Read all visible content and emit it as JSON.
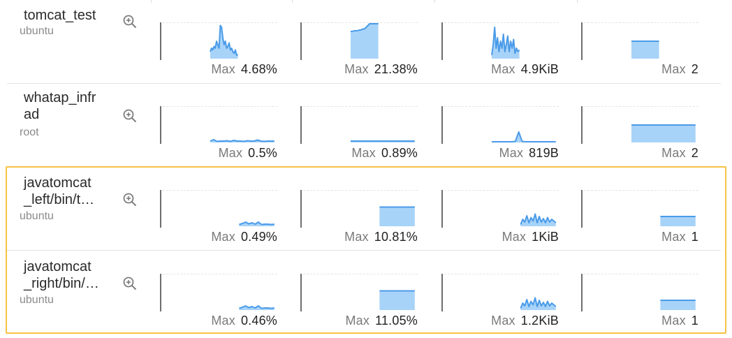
{
  "colors": {
    "accent": "#4a9be8",
    "fill": "#a8d3f8",
    "highlight": "#f6c244"
  },
  "rows": [
    {
      "name": "tomcat_test",
      "user": "ubuntu",
      "icon": "zoom-in-icon",
      "metrics": [
        {
          "max_label": "Max",
          "max_value": "4.68%",
          "shape": "spike"
        },
        {
          "max_label": "Max",
          "max_value": "21.38%",
          "shape": "rise"
        },
        {
          "max_label": "Max",
          "max_value": "4.9KiB",
          "shape": "jagged"
        },
        {
          "max_label": "Max",
          "max_value": "2",
          "shape": "block-mid"
        }
      ]
    },
    {
      "name": "whatap_infr\nad",
      "user": "root",
      "icon": "zoom-in-icon",
      "metrics": [
        {
          "max_label": "Max",
          "max_value": "0.5%",
          "shape": "flat-noise"
        },
        {
          "max_label": "Max",
          "max_value": "0.89%",
          "shape": "flat"
        },
        {
          "max_label": "Max",
          "max_value": "819B",
          "shape": "single-spike"
        },
        {
          "max_label": "Max",
          "max_value": "2",
          "shape": "block-wide"
        }
      ]
    },
    {
      "name": "javatomcat\n_left/bin/t…",
      "user": "ubuntu",
      "icon": "zoom-in-icon",
      "metrics": [
        {
          "max_label": "Max",
          "max_value": "0.49%",
          "shape": "low-noise"
        },
        {
          "max_label": "Max",
          "max_value": "10.81%",
          "shape": "block-tall"
        },
        {
          "max_label": "Max",
          "max_value": "1KiB",
          "shape": "small-jagged"
        },
        {
          "max_label": "Max",
          "max_value": "1",
          "shape": "block-short"
        }
      ]
    },
    {
      "name": "javatomcat\n_right/bin/…",
      "user": "ubuntu",
      "icon": "zoom-in-icon",
      "metrics": [
        {
          "max_label": "Max",
          "max_value": "0.46%",
          "shape": "low-noise"
        },
        {
          "max_label": "Max",
          "max_value": "11.05%",
          "shape": "block-tall"
        },
        {
          "max_label": "Max",
          "max_value": "1.2KiB",
          "shape": "small-jagged"
        },
        {
          "max_label": "Max",
          "max_value": "1",
          "shape": "block-short"
        }
      ]
    }
  ]
}
